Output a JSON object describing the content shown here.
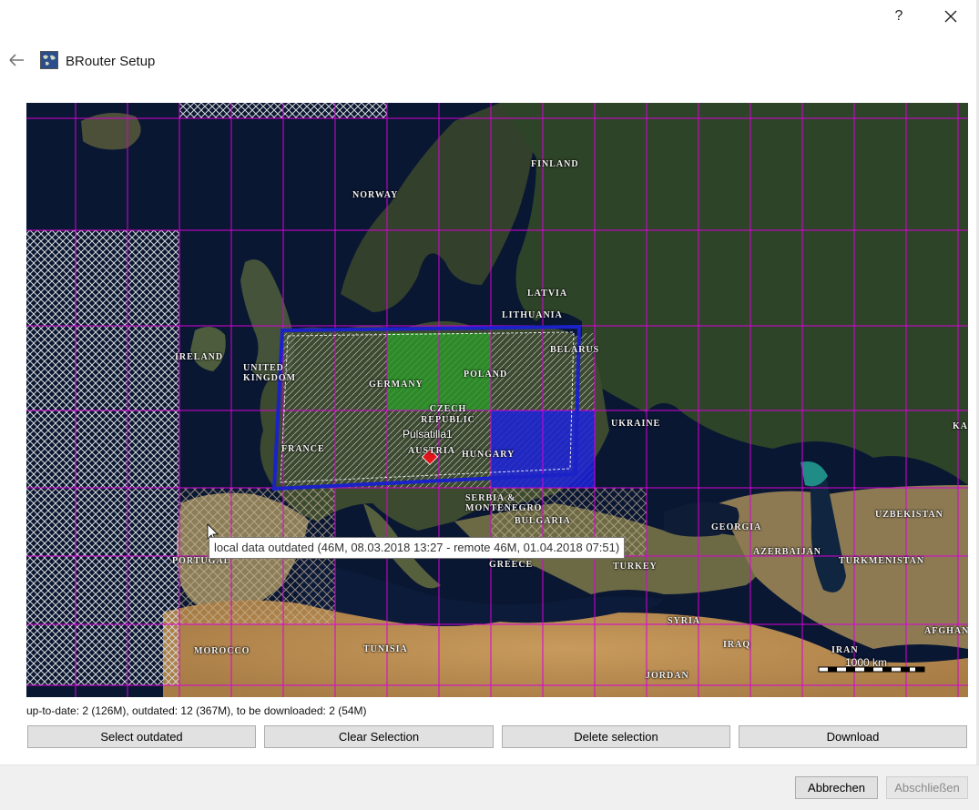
{
  "window": {
    "title": "BRouter Setup",
    "help_label": "?",
    "icons": {
      "back": "arrow-left-icon",
      "app": "world-map-icon",
      "close": "close-icon",
      "help": "question-icon"
    }
  },
  "map": {
    "countries": [
      "NORWAY",
      "FINLAND",
      "LATVIA",
      "LITHUANIA",
      "IRELAND",
      "UNITED KINGDOM",
      "GERMANY",
      "POLAND",
      "BELARUS",
      "CZECH REPUBLIC",
      "FRANCE",
      "AUSTRIA",
      "HUNGARY",
      "UKRAINE",
      "SERBIA & MONTENEGRO",
      "BULGARIA",
      "GEORGIA",
      "UZBEKISTAN",
      "AZERBAIJAN",
      "TURKMENISTAN",
      "PORTUGAL",
      "GREECE",
      "TURKEY",
      "SYRIA",
      "IRAQ",
      "IRAN",
      "AFGHAN",
      "MOROCCO",
      "TUNISIA",
      "JORDAN",
      "KA"
    ],
    "marker_label": "Pulsatilla1",
    "scale_label": "1000 km",
    "tooltip": "local data outdated (46M, 08.03.2018 13:27 - remote 46M, 01.04.2018 07:51)",
    "colors": {
      "grid": "#d800d8",
      "selected": "#2a9b28",
      "to_download": "#1b22d8",
      "selection_frame": "#1a22c8",
      "marker": "#e2151b"
    }
  },
  "status_text": "up-to-date: 2 (126M), outdated: 12 (367M), to be downloaded: 2 (54M)",
  "actions": {
    "select_outdated": "Select outdated",
    "clear_selection": "Clear Selection",
    "delete_selection": "Delete selection",
    "download": "Download"
  },
  "footer": {
    "cancel": "Abbrechen",
    "finish": "Abschließen"
  }
}
